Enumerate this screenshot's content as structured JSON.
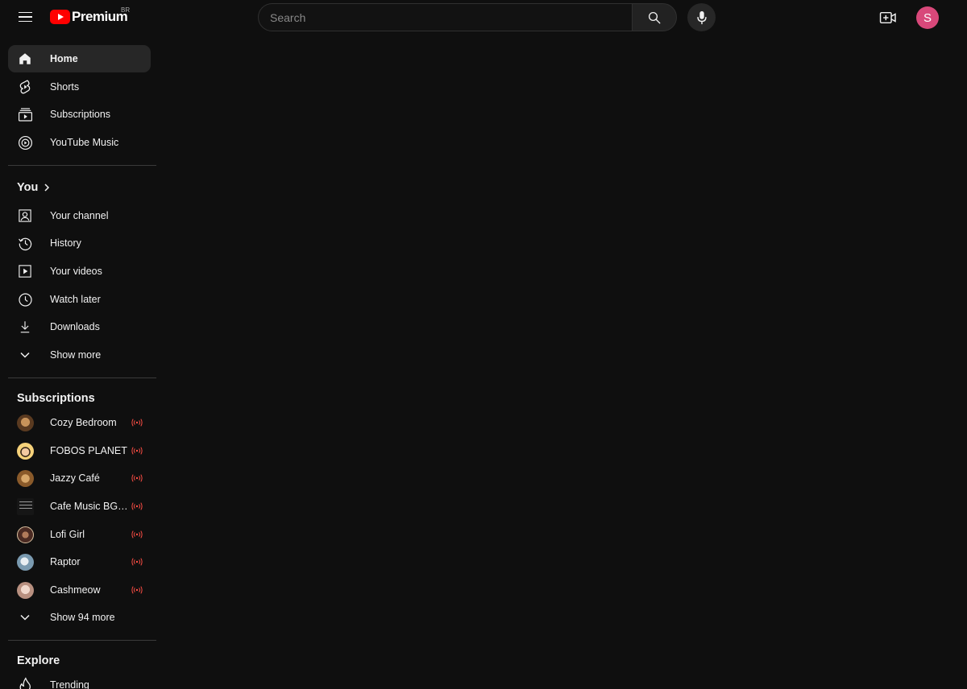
{
  "header": {
    "logo_text": "Premium",
    "country_code": "BR",
    "search_placeholder": "Search",
    "avatar_initial": "S"
  },
  "sidebar": {
    "main": [
      {
        "label": "Home",
        "icon": "home-icon",
        "active": true
      },
      {
        "label": "Shorts",
        "icon": "shorts-icon"
      },
      {
        "label": "Subscriptions",
        "icon": "subscriptions-icon"
      },
      {
        "label": "YouTube Music",
        "icon": "youtube-music-icon"
      }
    ],
    "you": {
      "title": "You",
      "items": [
        {
          "label": "Your channel",
          "icon": "your-channel-icon"
        },
        {
          "label": "History",
          "icon": "history-icon"
        },
        {
          "label": "Your videos",
          "icon": "your-videos-icon"
        },
        {
          "label": "Watch later",
          "icon": "watch-later-icon"
        },
        {
          "label": "Downloads",
          "icon": "download-icon"
        },
        {
          "label": "Show more",
          "icon": "chevron-down-icon"
        }
      ]
    },
    "subscriptions": {
      "title": "Subscriptions",
      "channels": [
        {
          "label": "Cozy Bedroom",
          "live": true,
          "color": "#6b4a2a"
        },
        {
          "label": "FOBOS PLANET",
          "live": true,
          "color": "#e8c27a"
        },
        {
          "label": "Jazzy Café",
          "live": true,
          "color": "#a06a32"
        },
        {
          "label": "Cafe Music BGM channel",
          "live": true,
          "color": "#1a1a1a"
        },
        {
          "label": "Lofi Girl",
          "live": true,
          "color": "#5a3a2e"
        },
        {
          "label": "Raptor",
          "live": true,
          "color": "#9fb6c8"
        },
        {
          "label": "Cashmeow",
          "live": true,
          "color": "#d9b8a8"
        }
      ],
      "show_more": "Show 94 more"
    },
    "explore": {
      "title": "Explore",
      "items": [
        {
          "label": "Trending",
          "icon": "trending-icon"
        }
      ]
    }
  },
  "colors": {
    "background": "#0f0f0f",
    "active_item": "#272727",
    "brand_red": "#ff0000",
    "live_red": "#ff4e45",
    "avatar": "#d8487a"
  }
}
